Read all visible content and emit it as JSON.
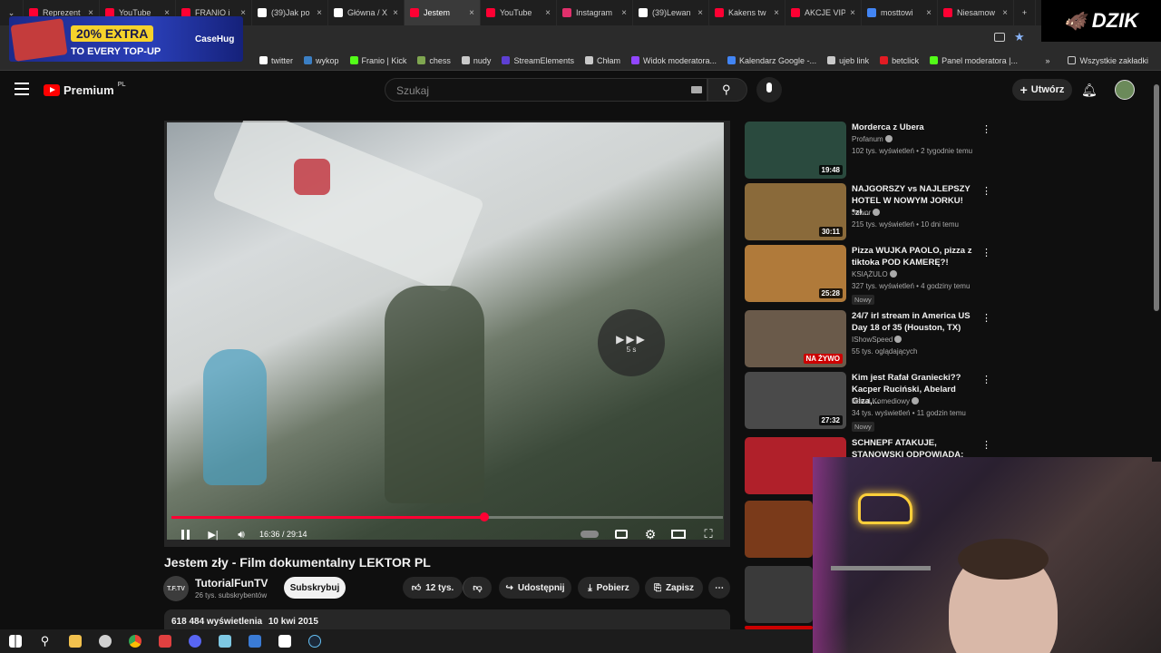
{
  "browser": {
    "tabs": [
      {
        "label": "Reprezent",
        "color": "#ff0033",
        "active": false
      },
      {
        "label": "YouTube",
        "color": "#ff0033",
        "active": false
      },
      {
        "label": "FRANIO i",
        "color": "#ff0033",
        "active": false
      },
      {
        "label": "(39)Jak po",
        "color": "#ffffff",
        "active": false
      },
      {
        "label": "Główna / X",
        "color": "#ffffff",
        "active": false
      },
      {
        "label": "Jestem",
        "color": "#ff0033",
        "active": true
      },
      {
        "label": "YouTube",
        "color": "#ff0033",
        "active": false
      },
      {
        "label": "Instagram",
        "color": "#e1306c",
        "active": false
      },
      {
        "label": "(39)Lewan",
        "color": "#ffffff",
        "active": false
      },
      {
        "label": "Kakens tw",
        "color": "#ff0033",
        "active": false
      },
      {
        "label": "AKCJE VIP",
        "color": "#ff0033",
        "active": false
      },
      {
        "label": "mosttowi",
        "color": "#4285f4",
        "active": false
      },
      {
        "label": "Niesamow",
        "color": "#ff0033",
        "active": false
      }
    ],
    "bookmarks": [
      {
        "label": "twitter",
        "color": "#ffffff"
      },
      {
        "label": "wykop",
        "color": "#3b7fc4"
      },
      {
        "label": "Franio | Kick",
        "color": "#53fc18"
      },
      {
        "label": "chess",
        "color": "#7fa650"
      },
      {
        "label": "nudy",
        "color": "#c9c9c9"
      },
      {
        "label": "StreamElements",
        "color": "#5d3fd3"
      },
      {
        "label": "Chłam",
        "color": "#c9c9c9"
      },
      {
        "label": "Widok moderatora...",
        "color": "#9146ff"
      },
      {
        "label": "Kalendarz Google -...",
        "color": "#4285f4"
      },
      {
        "label": "ujeb link",
        "color": "#c9c9c9"
      },
      {
        "label": "betclick",
        "color": "#e21b23"
      },
      {
        "label": "Panel moderatora |...",
        "color": "#53fc18"
      }
    ],
    "all_bookmarks": "Wszystkie zakładki"
  },
  "ad": {
    "promo": "20% EXTRA",
    "sub": "TO EVERY TOP-UP",
    "brand": "CaseHug"
  },
  "overlay": {
    "logo_text": "DZIK"
  },
  "youtube": {
    "logo": "Premium",
    "logo_region": "PL",
    "search_placeholder": "Szukaj",
    "create_label": "Utwórz"
  },
  "player": {
    "skip_label": "5 s",
    "time": "16:36 / 29:14",
    "progress_fraction": 0.568
  },
  "video": {
    "title": "Jestem zły - Film dokumentalny LEKTOR PL",
    "channel": "TutorialFunTV",
    "channel_avatar": "T.F.TV",
    "subscribers": "26 tys. subskrybentów",
    "subscribe_label": "Subskrybuj",
    "likes": "12 tys.",
    "share_label": "Udostępnij",
    "download_label": "Pobierz",
    "save_label": "Zapisz",
    "views": "618 484 wyświetlenia",
    "date": "10 kwi 2015"
  },
  "recommendations": [
    {
      "title": "Morderca z Ubera",
      "channel": "Profanum",
      "meta": "102 tys. wyświetleń • 2 tygodnie temu",
      "duration": "19:48",
      "badge": "",
      "thumb": "#2a4a3e"
    },
    {
      "title": "NAJGORSZY vs NAJLEPSZY HOTEL W NOWYM JORKU! *zł...",
      "channel": "Jawor",
      "meta": "215 tys. wyświetleń • 10 dni temu",
      "duration": "30:11",
      "badge": "",
      "thumb": "#8a6a3a"
    },
    {
      "title": "Pizza WUJKA PAOLO, pizza z tiktoka POD KAMERĘ?!",
      "channel": "KSIĄŻULO",
      "meta": "327 tys. wyświetleń • 4 godziny temu",
      "duration": "25:28",
      "badge": "Nowy",
      "thumb": "#b07a3a"
    },
    {
      "title": "24/7 irl stream in America US Day 18 of 35 (Houston, TX)",
      "channel": "IShowSpeed",
      "meta": "55 tys. oglądających",
      "duration": "NA ŻYWO",
      "badge": "",
      "thumb": "#6a5a4a"
    },
    {
      "title": "Kim jest Rafał Graniecki?? Kacper Ruciński, Abelard Giza,...",
      "channel": "Kanał Komediowy",
      "meta": "34 tys. wyświetleń • 11 godzin temu",
      "duration": "27:32",
      "badge": "Nowy",
      "thumb": "#4a4a4a"
    },
    {
      "title": "SCHNEPF ATAKUJE, STANOWSKI ODPOWIADA:",
      "channel": "",
      "meta": "",
      "duration": "",
      "badge": "",
      "thumb": "#b0202a"
    }
  ]
}
